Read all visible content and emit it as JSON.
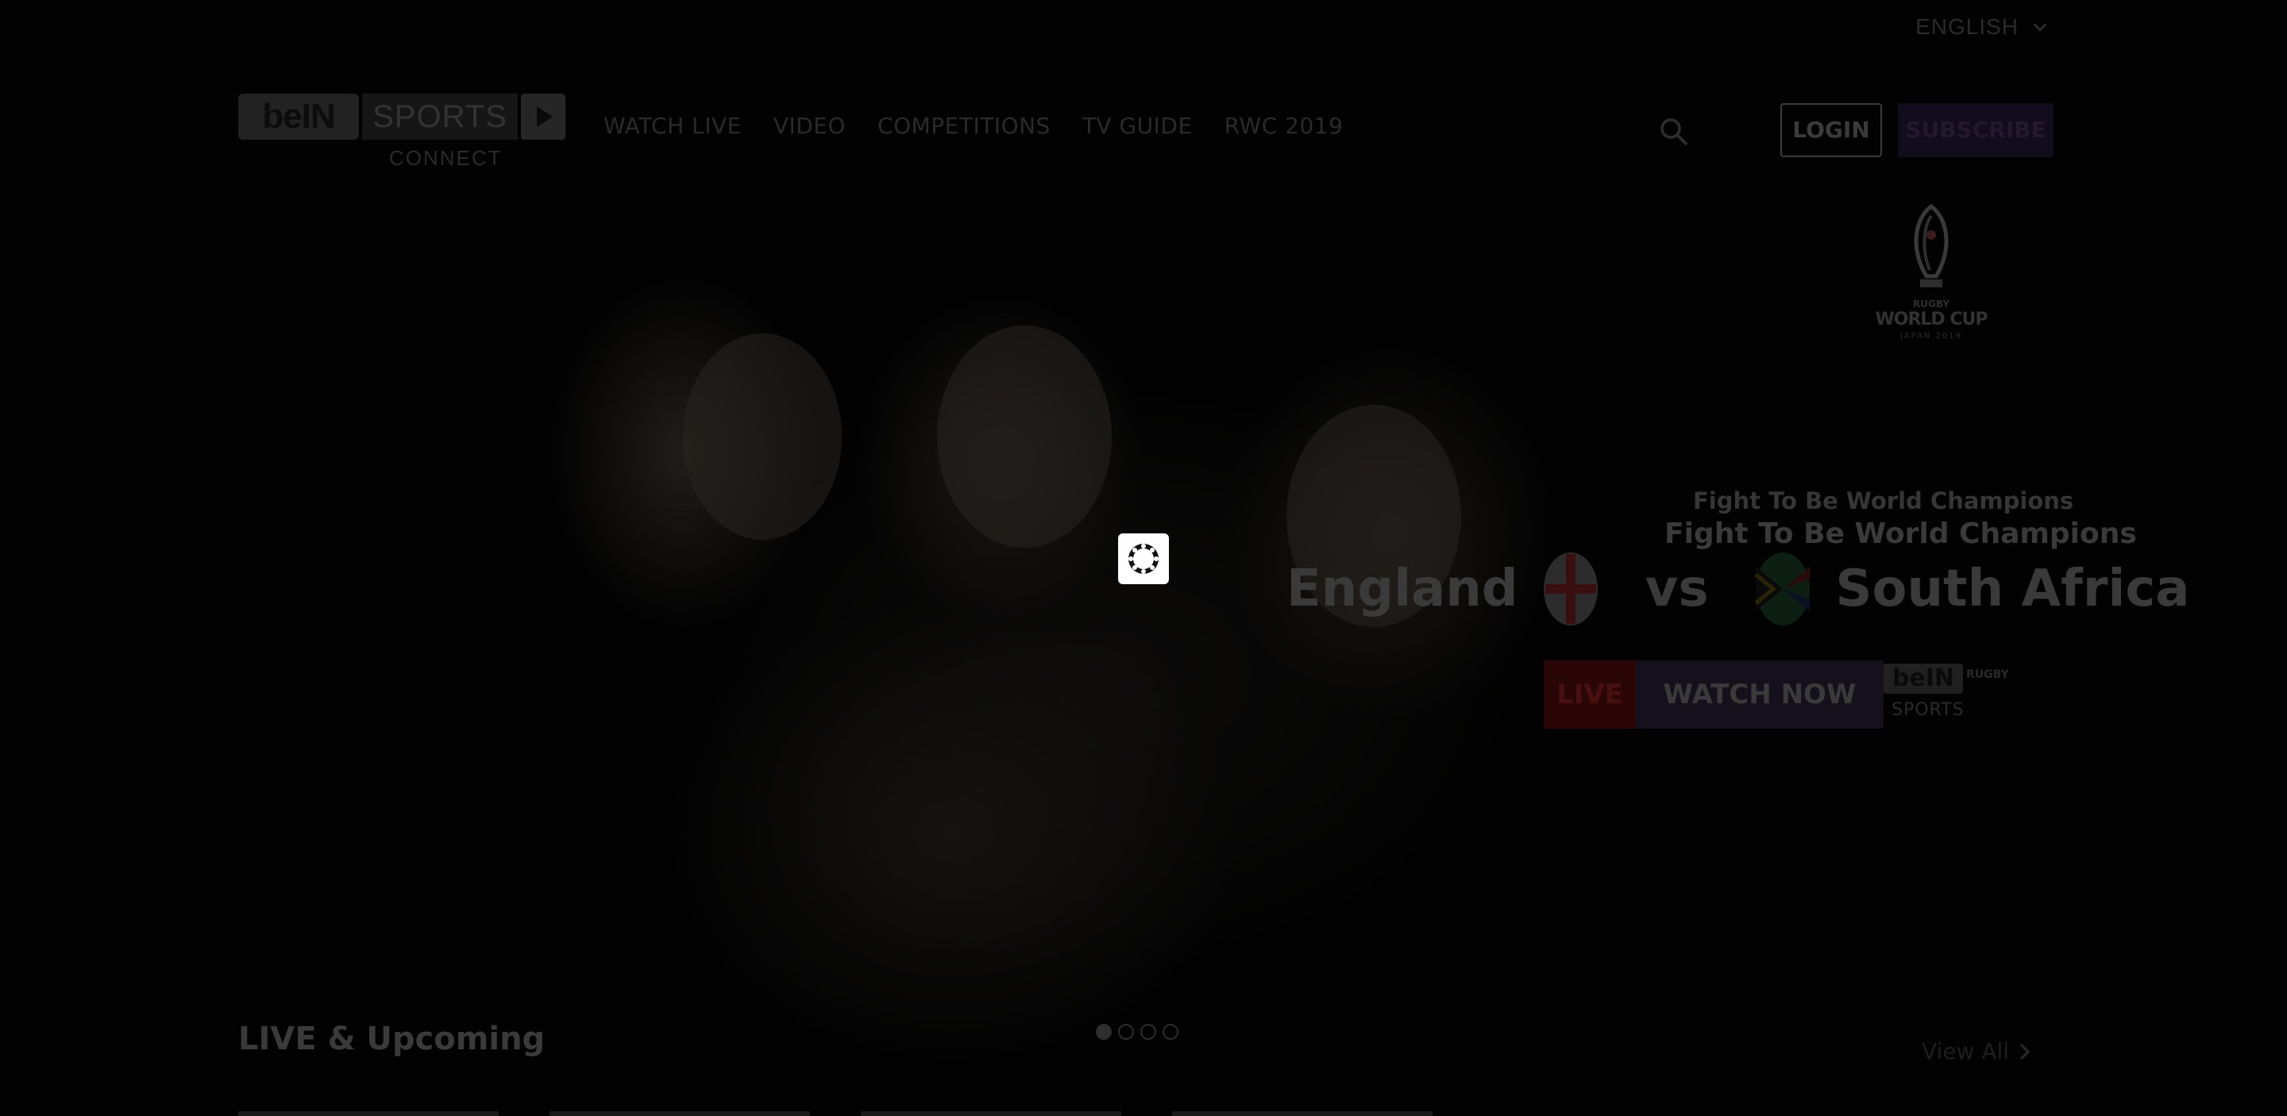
{
  "header": {
    "language": "ENGLISH",
    "logo": {
      "brand": "beIN",
      "sports": "SPORTS",
      "connect": "CONNECT"
    },
    "nav": [
      "WATCH LIVE",
      "VIDEO",
      "COMPETITIONS",
      "TV GUIDE",
      "RWC 2019"
    ],
    "login_label": "LOGIN",
    "subscribe_label": "SUBSCRIBE"
  },
  "hero": {
    "rwc_logo": {
      "line1": "RUGBY",
      "line2": "WORLD CUP",
      "line3": "JAPAN 2019"
    },
    "tagline_small": "Fight To Be World Champions",
    "tagline_big": "Fight To Be World Champions",
    "team_home": "England",
    "vs": "vs",
    "team_away": "South Africa",
    "live_label": "LIVE",
    "watch_label": "WATCH NOW",
    "channel": {
      "brand": "beIN",
      "sub": "RUGBY",
      "sports": "SPORTS"
    },
    "slides_total": 4,
    "active_slide": 1
  },
  "section": {
    "title": "LIVE & Upcoming",
    "view_all": "View All"
  },
  "colors": {
    "background": "#020202",
    "overlay_text": "#3a3a3a",
    "live_badge": "#2a0606",
    "loader_bg": "#ffffff"
  },
  "icons": {
    "search": "search-icon",
    "language_dropdown": "chevron-down-icon",
    "loader": "loading-spinner-icon",
    "view_all": "chevron-right-icon"
  }
}
